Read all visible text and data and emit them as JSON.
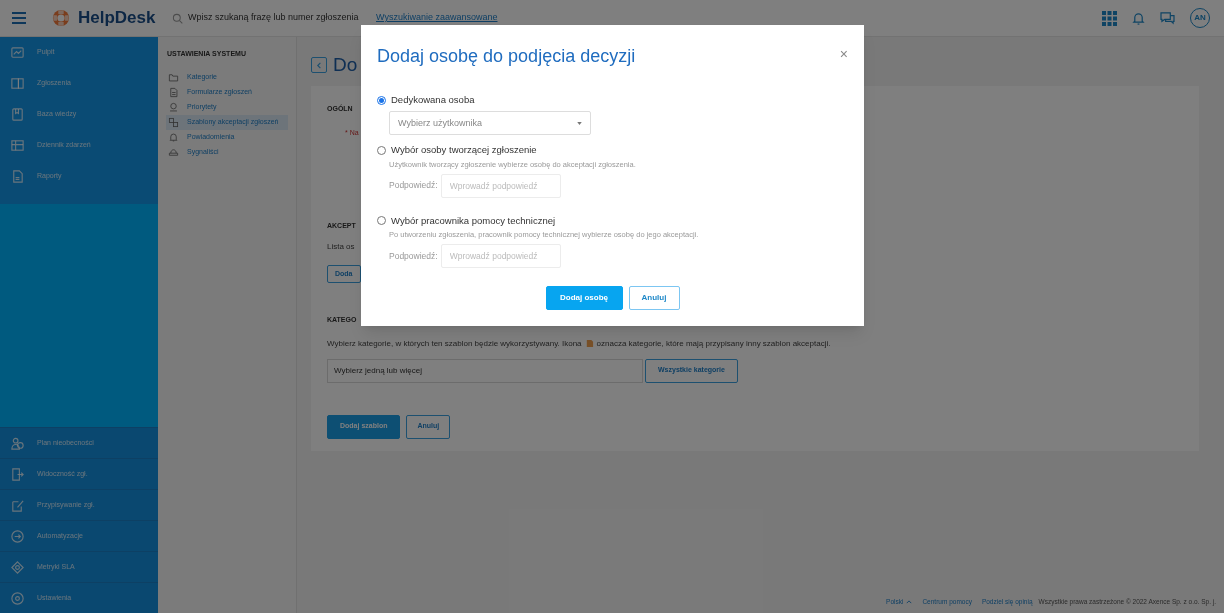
{
  "top_bar": {
    "app_name": "HelpDesk",
    "search": {
      "placeholder": "Wpisz szukaną frazę lub numer zgłoszenia"
    },
    "advanced_search": "Wyszukiwanie zaawansowane",
    "avatar": "AN"
  },
  "sidebar": {
    "top_items": [
      {
        "kind": "dashboard",
        "label": "Pulpit"
      },
      {
        "kind": "tickets",
        "label": "Zgłoszenia"
      },
      {
        "kind": "book",
        "label": "Baza wiedzy"
      },
      {
        "kind": "log",
        "label": "Dziennik zdarzeń"
      },
      {
        "kind": "report",
        "label": "Raporty"
      }
    ],
    "bottom_items": [
      {
        "kind": "people",
        "label": "Plan nieobecności"
      },
      {
        "kind": "visibility",
        "label": "Widoczność zgł."
      },
      {
        "kind": "assign",
        "label": "Przypisywanie zgł."
      },
      {
        "kind": "automation",
        "label": "Automatyzacje"
      },
      {
        "kind": "sla",
        "label": "Metryki SLA"
      },
      {
        "kind": "gear",
        "label": "Ustawienia"
      }
    ]
  },
  "settings_menu": {
    "heading": "USTAWIENIA SYSTEMU",
    "items": [
      {
        "kind": "folder",
        "label": "Kategorie",
        "selected": false
      },
      {
        "kind": "form",
        "label": "Formularze zgłoszeń",
        "selected": false
      },
      {
        "kind": "priority",
        "label": "Priorytety",
        "selected": false
      },
      {
        "kind": "template",
        "label": "Szablony akceptacji zgłoszeń",
        "selected": true
      },
      {
        "kind": "bell",
        "label": "Powiadomienia",
        "selected": false
      },
      {
        "kind": "whistle",
        "label": "Sygnaliści",
        "selected": false
      }
    ]
  },
  "page": {
    "title": "Do",
    "general_heading": "OGÓLN",
    "name_label": "* Na",
    "acceptance_heading": "AKCEPT",
    "acceptance_text": "Lista os",
    "acceptance_button": "Doda",
    "categories_heading": "KATEGO",
    "categories_text_before": "Wybierz kategorie, w których ten szablon będzie wykorzystywany. Ikona",
    "categories_text_after": "oznacza kategorie, które mają przypisany inny szablon akceptacji.",
    "categories_field": {
      "placeholder": "Wybierz jedną lub więcej"
    },
    "all_categories_button": "Wszystkie kategorie",
    "buttons": [
      {
        "kind": "primary",
        "label": "Dodaj szablon"
      },
      {
        "kind": "secondary",
        "label": "Anuluj"
      }
    ]
  },
  "footer": {
    "language": "Polski",
    "links": [
      "Centrum pomocy",
      "Podziel się opinią"
    ],
    "copyright": "Wszystkie prawa zastrzeżone © 2022 Axence Sp. z o.o. Sp. j."
  },
  "dialog": {
    "title": "Dodaj osobę do podjęcia decyzji",
    "close": "×",
    "options": [
      {
        "kind": "select",
        "label": "Dedykowana osoba",
        "selected": true,
        "select_placeholder": "Wybierz użytkownika"
      },
      {
        "kind": "hint",
        "label": "Wybór osoby tworzącej zgłoszenie",
        "selected": false,
        "description": "Użytkownik tworzący zgłoszenie wybierze osobę do akceptacji zgłoszenia.",
        "hint_label": "Podpowiedź:",
        "hint_placeholder": "Wprowadź podpowiedź"
      },
      {
        "kind": "hint",
        "label": "Wybór pracownika pomocy technicznej",
        "selected": false,
        "description": "Po utworzeniu zgłoszenia, pracownik pomocy technicznej wybierze osobę do jego akceptacji.",
        "hint_label": "Podpowiedź:",
        "hint_placeholder": "Wprowadź podpowiedź"
      }
    ],
    "buttons": [
      {
        "kind": "primary",
        "label": "Dodaj osobę"
      },
      {
        "kind": "secondary",
        "label": "Anuluj"
      }
    ]
  }
}
